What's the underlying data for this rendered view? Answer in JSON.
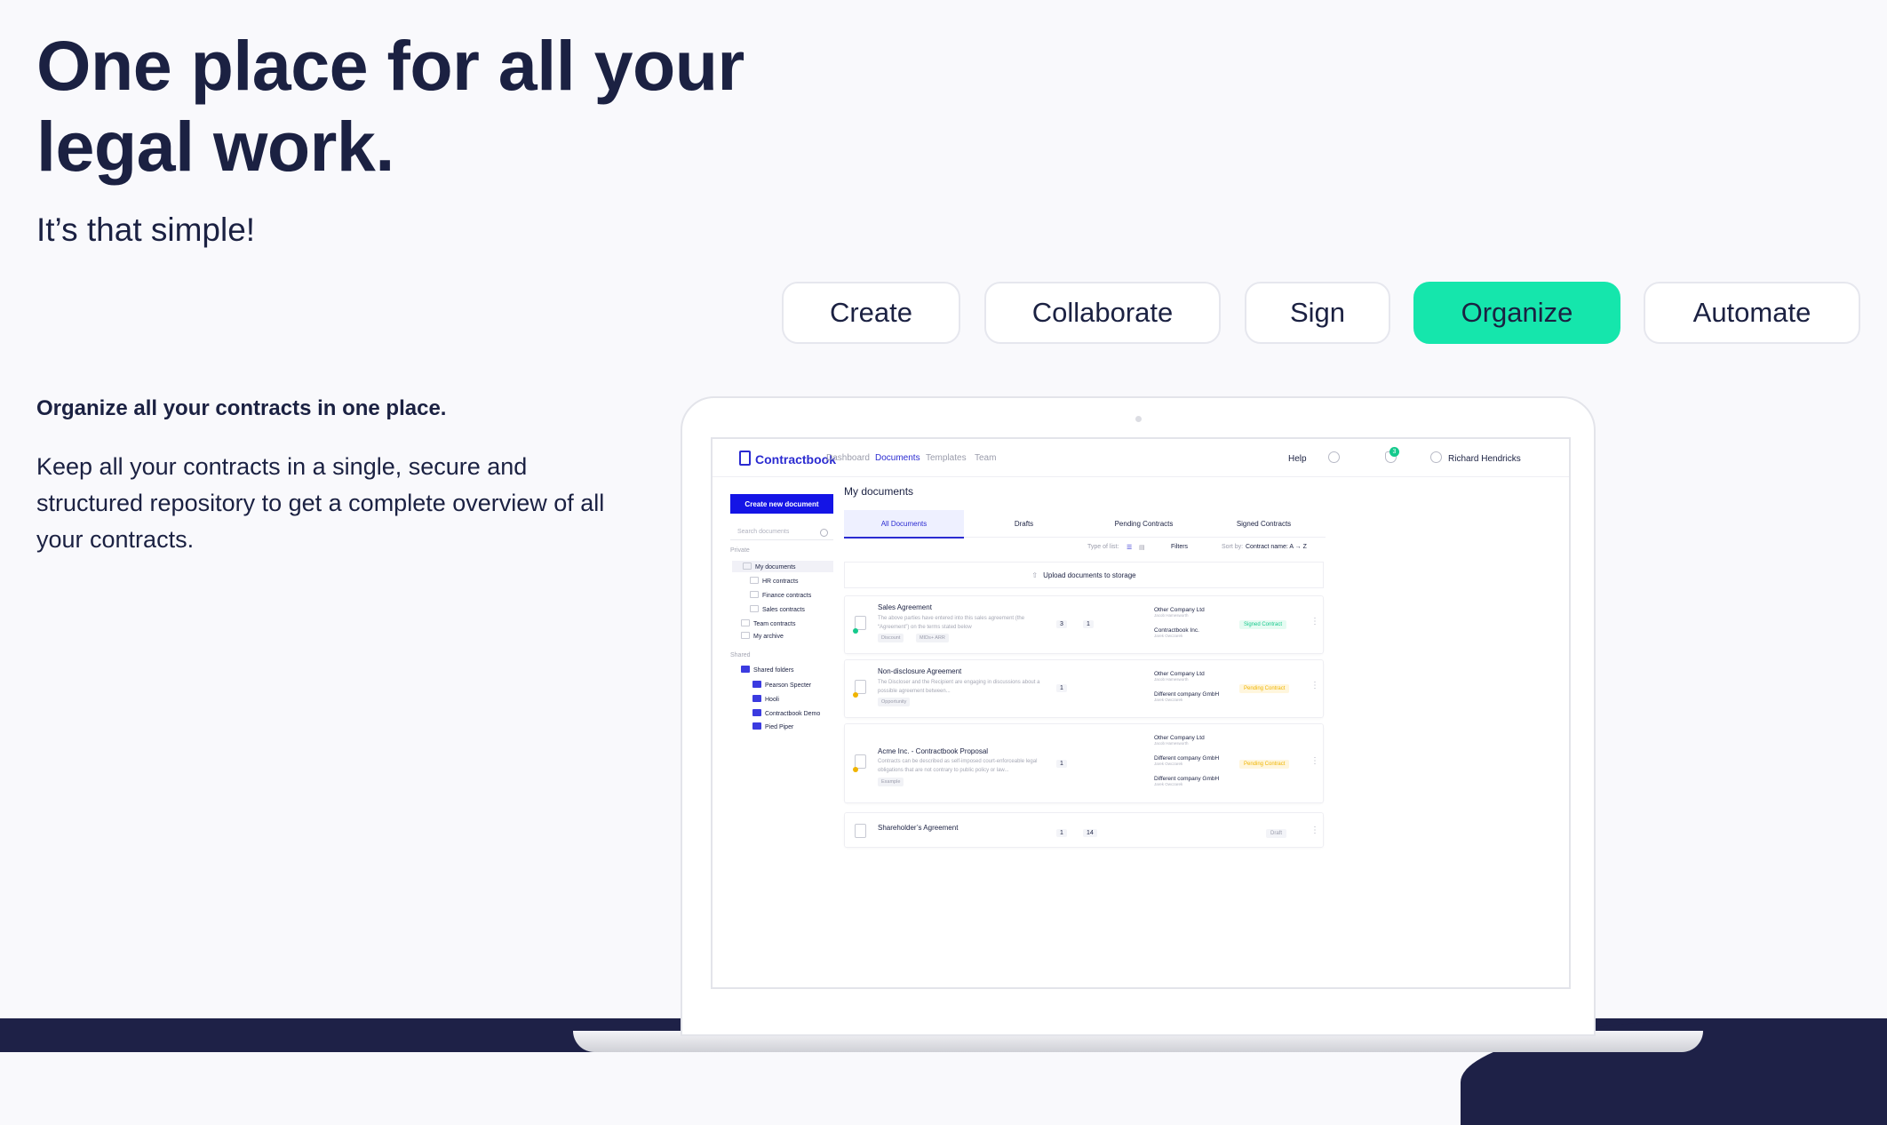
{
  "hero": {
    "title": "One place for all your legal work.",
    "subtitle": "It’s that simple!"
  },
  "tabs": [
    {
      "label": "Create",
      "active": false
    },
    {
      "label": "Collaborate",
      "active": false
    },
    {
      "label": "Sign",
      "active": false
    },
    {
      "label": "Organize",
      "active": true
    },
    {
      "label": "Automate",
      "active": false
    }
  ],
  "feature": {
    "title": "Organize all your contracts in one place.",
    "body": "Keep all your contracts in a single, secure and structured repository to get a complete overview of all your contracts."
  },
  "colors": {
    "accent": "#15e6ac",
    "navy": "#1b2142",
    "brand_blue": "#1414e6"
  },
  "app": {
    "logo": "Contractbook",
    "nav": [
      "Dashboard",
      "Documents",
      "Templates",
      "Team"
    ],
    "nav_active": "Documents",
    "help": "Help",
    "notification_count": "3",
    "user": "Richard Hendricks",
    "create_button": "Create new document",
    "search_placeholder": "Search documents",
    "private_label": "Private",
    "shared_label": "Shared",
    "tree": {
      "my_documents": "My documents",
      "hr": "HR contracts",
      "finance": "Finance contracts",
      "sales": "Sales contracts",
      "team": "Team contracts",
      "archive": "My archive",
      "shared_folders": "Shared folders",
      "pearson": "Pearson Specter",
      "hooli": "Hooli",
      "cb_demo": "Contractbook Demo",
      "pied": "Pied Piper"
    },
    "main_title": "My documents",
    "doc_tabs": [
      "All Documents",
      "Drafts",
      "Pending Contracts",
      "Signed Contracts"
    ],
    "type_of_list": "Type of list:",
    "filters": "Filters",
    "sort_label": "Sort by:",
    "sort_value": "Contract name: A → Z",
    "upload": "Upload documents to storage",
    "documents": [
      {
        "title": "Sales Agreement",
        "desc": "The above parties have entered into this sales agreement (the “Agreement”) on the terms stated below",
        "tags": [
          "Discount",
          "MIDs+ ARR"
        ],
        "comments": "3",
        "attachments": "1",
        "party1": "Other Company Ltd",
        "party1_sub": "Jacob Hamesworth",
        "party2": "Contractbook Inc.",
        "party2_sub": "Jarek Owczarek",
        "status": "Signed Contract"
      },
      {
        "title": "Non-disclosure Agreement",
        "desc": "The Discloser and the Recipient are engaging in discussions about a possible agreement between...",
        "tags": [
          "Opportunity"
        ],
        "comments": "1",
        "party1": "Other Company Ltd",
        "party1_sub": "Jacob Hamesworth",
        "party2": "Different company GmbH",
        "party2_sub": "Jarek Owczarek",
        "status": "Pending Contract"
      },
      {
        "title": "Acme Inc. - Contractbook Proposal",
        "desc": "Contracts can be described as self-imposed court-enforceable legal obligations that are not contrary to public policy or law...",
        "tags": [
          "Example"
        ],
        "comments": "1",
        "party1": "Other Company Ltd",
        "party1_sub": "Jacob Hamesworth",
        "party2": "Different company GmbH",
        "party2_sub": "Jarek Owczarek",
        "party3": "Different company GmbH",
        "party3_sub": "Jarek Owczarek",
        "status": "Pending Contract"
      },
      {
        "title": "Shareholder’s Agreement",
        "comments": "1",
        "attachments": "14",
        "status": "Draft"
      }
    ]
  }
}
